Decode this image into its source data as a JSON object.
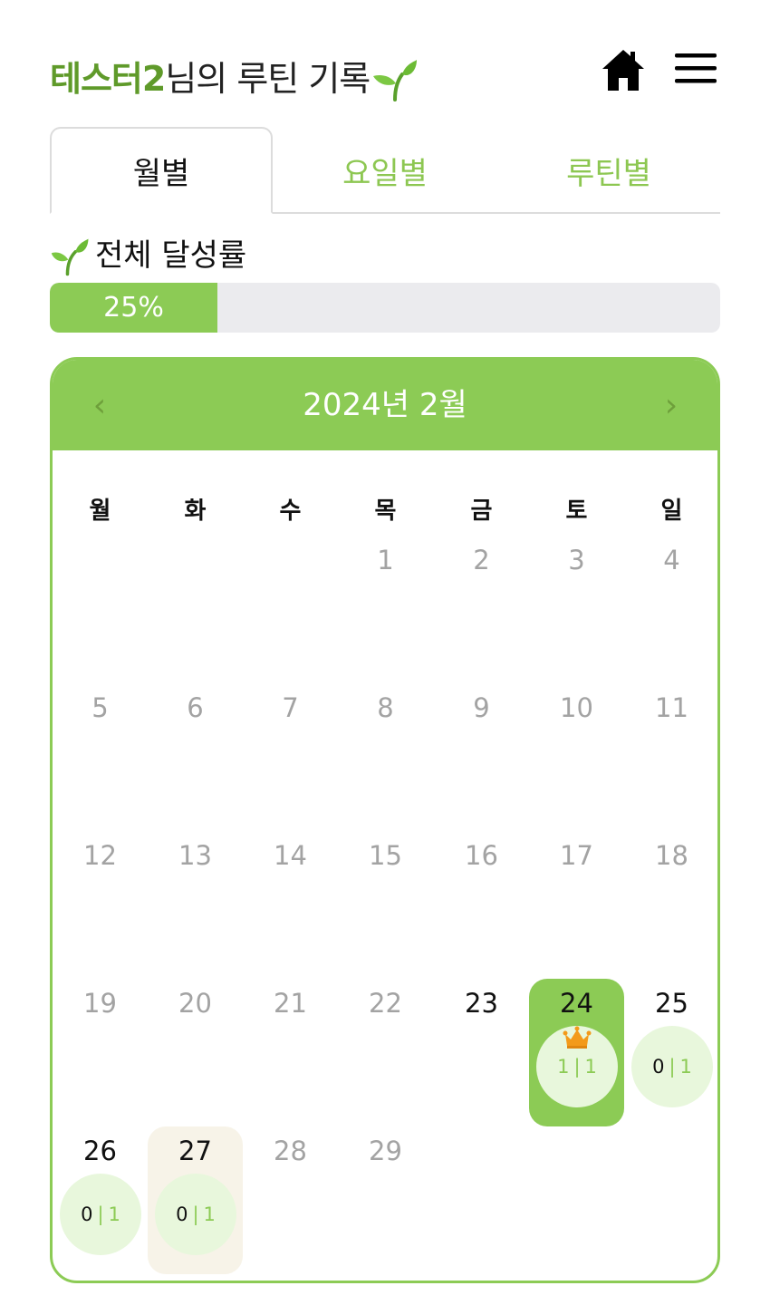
{
  "header": {
    "user_name": "테스터2",
    "title_suffix": "님의 루틴 기록"
  },
  "tabs": [
    {
      "label": "월별",
      "active": true
    },
    {
      "label": "요일별",
      "active": false
    },
    {
      "label": "루틴별",
      "active": false
    }
  ],
  "summary": {
    "label": "전체 달성률",
    "progress_text": "25%",
    "progress_value": 0.25
  },
  "calendar": {
    "title": "2024년 2월",
    "prev_symbol": "‹",
    "next_symbol": "›",
    "weekdays": [
      "월",
      "화",
      "수",
      "목",
      "금",
      "토",
      "일"
    ],
    "days": [
      "1",
      "2",
      "3",
      "4",
      "5",
      "6",
      "7",
      "8",
      "9",
      "10",
      "11",
      "12",
      "13",
      "14",
      "15",
      "16",
      "17",
      "18",
      "19",
      "20",
      "21",
      "22",
      "23",
      "24",
      "25",
      "26",
      "27",
      "28",
      "29"
    ],
    "records": {
      "24": {
        "done": "1",
        "sep": "|",
        "total": "1"
      },
      "25": {
        "done": "0",
        "sep": "|",
        "total": "1"
      },
      "26": {
        "done": "0",
        "sep": "|",
        "total": "1"
      },
      "27": {
        "done": "0",
        "sep": "|",
        "total": "1"
      }
    }
  },
  "colors": {
    "accent": "#8ccb55",
    "accent_dark": "#5f9a2a",
    "badge_bg": "#e8f7dc",
    "today_bg": "#f7f3e8",
    "crown": "#f39a1a"
  },
  "icons": {
    "home": "home-icon",
    "menu": "hamburger-menu-icon",
    "sprout": "sprout-icon",
    "crown": "crown-icon"
  }
}
